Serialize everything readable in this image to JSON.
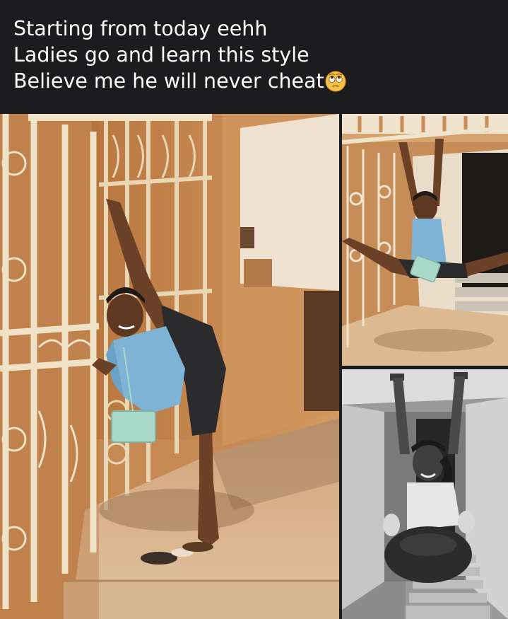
{
  "caption": {
    "lines": [
      "Starting from today eehh",
      "Ladies go and learn this style",
      "Believe me he will never cheat"
    ],
    "emoji": "face-with-rolling-eyes-icon"
  },
  "photos": [
    {
      "name": "standing-split-photo",
      "tone": "color"
    },
    {
      "name": "hanging-split-photo",
      "tone": "color"
    },
    {
      "name": "hanging-pose-photo",
      "tone": "grayscale"
    }
  ],
  "colors": {
    "background": "#1c1c1e",
    "caption_text": "#ffffff",
    "wall": "#c98a55",
    "gate": "#efe0c4",
    "shirt": "#7fb3d5",
    "shorts": "#2b2b2e",
    "bag": "#a9d8c8",
    "floor": "#d9b48c"
  }
}
